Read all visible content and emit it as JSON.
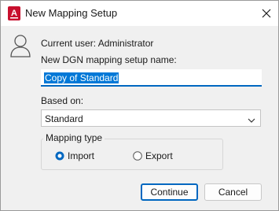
{
  "window": {
    "title": "New Mapping Setup",
    "app_icon": "autocad-icon"
  },
  "header": {
    "current_user": "Current user: Administrator"
  },
  "form": {
    "name_label": "New DGN mapping setup name:",
    "name_value": "Copy of Standard",
    "based_on_label": "Based on:",
    "based_on_value": "Standard"
  },
  "mapping_type": {
    "title": "Mapping type",
    "import_label": "Import",
    "export_label": "Export",
    "selected": "Import"
  },
  "buttons": {
    "continue": "Continue",
    "cancel": "Cancel"
  },
  "colors": {
    "accent": "#0067c0",
    "app_icon": "#c8102e"
  }
}
